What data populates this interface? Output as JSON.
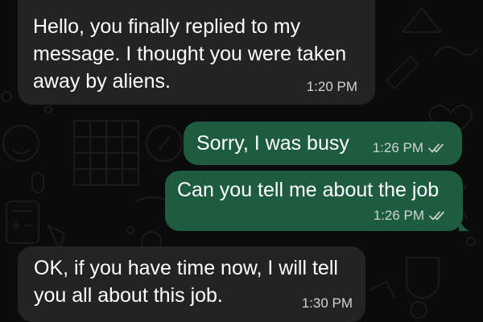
{
  "colors": {
    "background": "#0b0b0b",
    "incoming_bubble": "#232324",
    "outgoing_bubble": "#1e5c3f",
    "text": "#ffffff",
    "meta_text": "#cfd3d1"
  },
  "messages": [
    {
      "direction": "incoming",
      "text": "Hello, you finally replied to my\nmessage. I thought you were taken\naway by aliens.",
      "time": "1:20 PM",
      "status_icon": ""
    },
    {
      "direction": "outgoing",
      "text": "Sorry, I was busy",
      "time": "1:26 PM",
      "status_icon": "double-check-icon"
    },
    {
      "direction": "outgoing",
      "text": "Can you tell me about the job",
      "time": "1:26 PM",
      "status_icon": "double-check-icon"
    },
    {
      "direction": "incoming",
      "text": "OK, if you have time now, I will tell\nyou all about this job.",
      "time": "1:30 PM",
      "status_icon": ""
    }
  ]
}
